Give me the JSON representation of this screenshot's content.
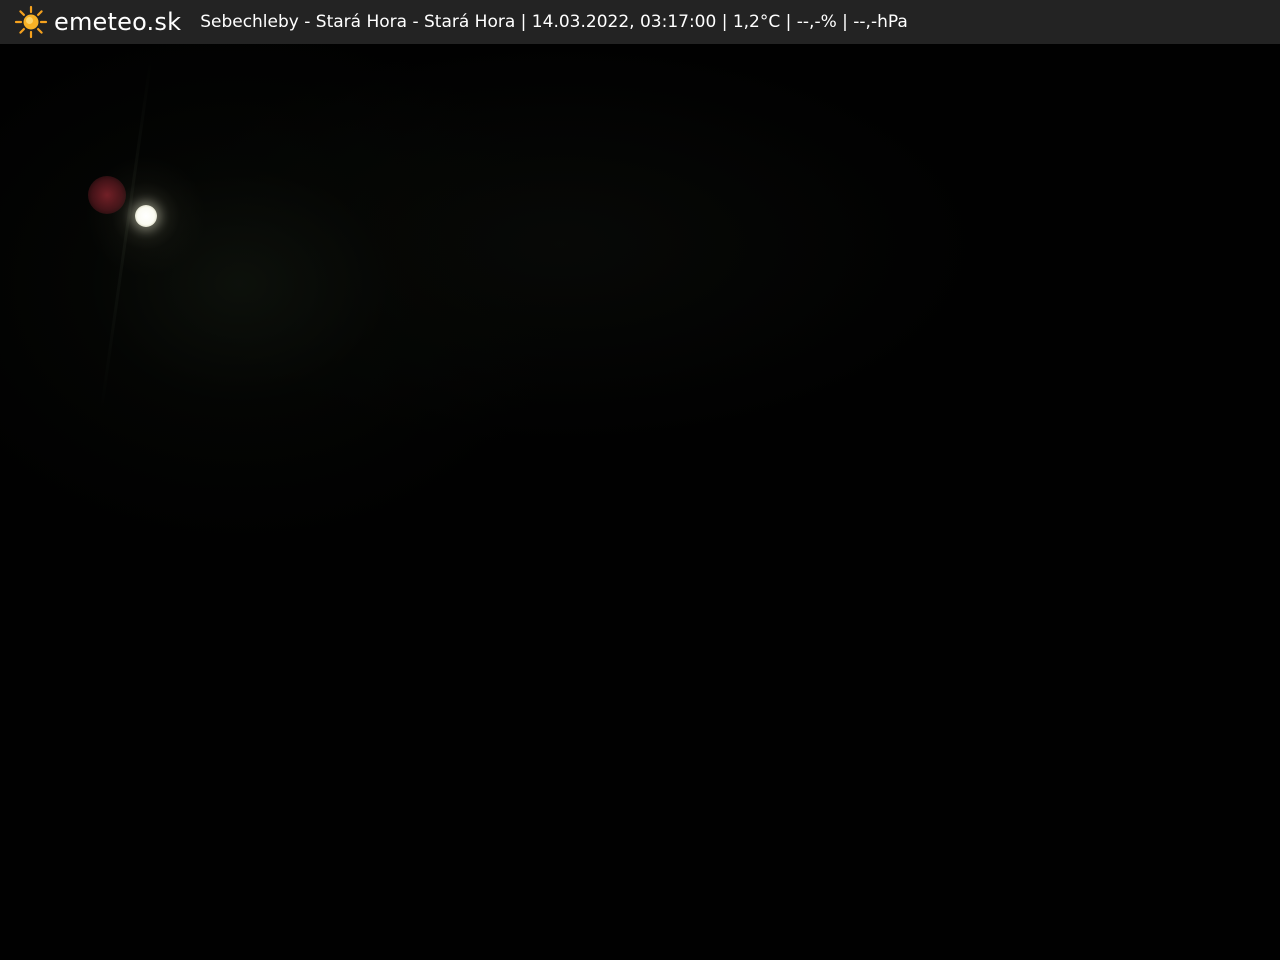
{
  "header": {
    "brand": "emeteo.sk",
    "logo_icon": "sun-icon",
    "caption": "Sebechleby - Stará Hora - Stará Hora | 14.03.2022, 03:17:00 | 1,2°C | --,-% | --,-hPa"
  },
  "colors": {
    "bar_background": "#232323",
    "brand_text": "#ffffff",
    "sun_orange": "#f6a21e",
    "sky": "#010101"
  }
}
